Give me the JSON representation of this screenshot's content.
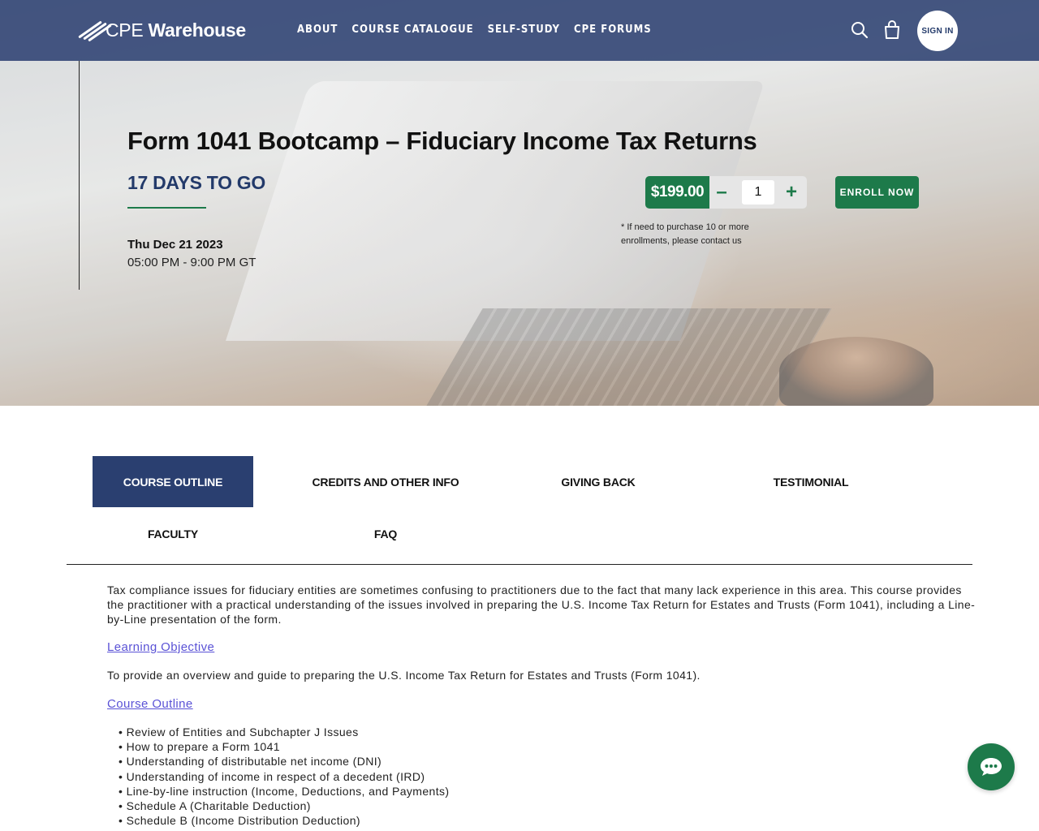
{
  "nav": {
    "logo_light": "CPE",
    "logo_bold": "Warehouse",
    "links": [
      "ABOUT",
      "COURSE CATALOGUE",
      "SELF-STUDY",
      "CPE FORUMS"
    ],
    "search_icon": "search-icon",
    "cart_icon": "cart-icon",
    "signin_label": "SIGN IN"
  },
  "hero": {
    "title": "Form 1041 Bootcamp – Fiduciary Income Tax Returns",
    "countdown": "17 DAYS TO GO",
    "date": "Thu Dec 21 2023",
    "time": "05:00 PM - 9:00 PM GT",
    "price": "$199.00",
    "qty_minus": "–",
    "qty_value": "1",
    "qty_plus": "+",
    "enroll_label": "ENROLL NOW",
    "note": "* If need to purchase 10 or more enrollments, please contact us"
  },
  "tabs": {
    "items": [
      "COURSE OUTLINE",
      "CREDITS AND OTHER INFO",
      "GIVING BACK",
      "TESTIMONIAL",
      "FACULTY",
      "FAQ"
    ],
    "active": "COURSE OUTLINE"
  },
  "content": {
    "intro": "Tax compliance issues for fiduciary entities are sometimes confusing to practitioners due to the fact that many lack experience in this area. This course provides the practitioner with a practical understanding of the issues involved in preparing the U.S. Income Tax Return for Estates and Trusts (Form 1041), including a Line-by-Line presentation of the form.",
    "objective_heading": "Learning Objective",
    "objective_text": "To provide an overview and guide to preparing the U.S. Income Tax Return for Estates and Trusts (Form 1041).",
    "outline_heading": "Course Outline",
    "outline_items": [
      "Review of Entities and Subchapter J Issues",
      "How to prepare a Form 1041",
      "Understanding of distributable net income (DNI)",
      "Understanding of income in respect of a decedent (IRD)",
      "Line-by-line instruction (Income, Deductions, and Payments)",
      "Schedule A (Charitable Deduction)",
      "Schedule B (Income Distribution Deduction)"
    ]
  },
  "chat": {
    "icon": "chat-icon"
  },
  "colors": {
    "brand_navy": "#2a3f70",
    "brand_green": "#1d7a4a",
    "link_purple": "#5a52d6"
  }
}
